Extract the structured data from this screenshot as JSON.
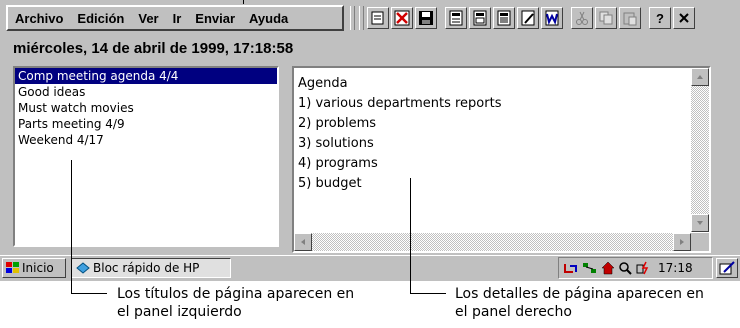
{
  "menubar": {
    "items": [
      {
        "label": "Archivo"
      },
      {
        "label": "Edición"
      },
      {
        "label": "Ver"
      },
      {
        "label": "Ir"
      },
      {
        "label": "Enviar"
      },
      {
        "label": "Ayuda"
      }
    ]
  },
  "toolbar": {
    "buttons": [
      "new-note-icon",
      "delete-icon",
      "save-icon",
      "page-icon",
      "page-duplicate-icon",
      "page-list-icon",
      "page-edit-icon",
      "word-icon",
      "cut-icon",
      "copy-icon",
      "paste-icon",
      "help-icon",
      "close-icon"
    ]
  },
  "header": {
    "date": "miércoles, 14 de abril de 1999, 17:18:58"
  },
  "left_panel": {
    "items": [
      "Comp meeting agenda 4/4",
      "Good ideas",
      "Must watch movies",
      "Parts meeting 4/9",
      "Weekend 4/17"
    ],
    "selected_index": 0
  },
  "right_panel": {
    "lines": [
      "Agenda",
      "1) various departments reports",
      "2) problems",
      "3) solutions",
      "4) programs",
      "5) budget"
    ]
  },
  "taskbar": {
    "start_label": "Inicio",
    "task_label": "Bloc rápido de HP",
    "clock": "17:18"
  },
  "captions": {
    "left": [
      "Los títulos de página aparecen en",
      "el panel izquierdo"
    ],
    "right": [
      "Los detalles de página aparecen en",
      "el panel derecho"
    ]
  },
  "colors": {
    "selection": "#000080",
    "face": "#c0c0c0"
  }
}
